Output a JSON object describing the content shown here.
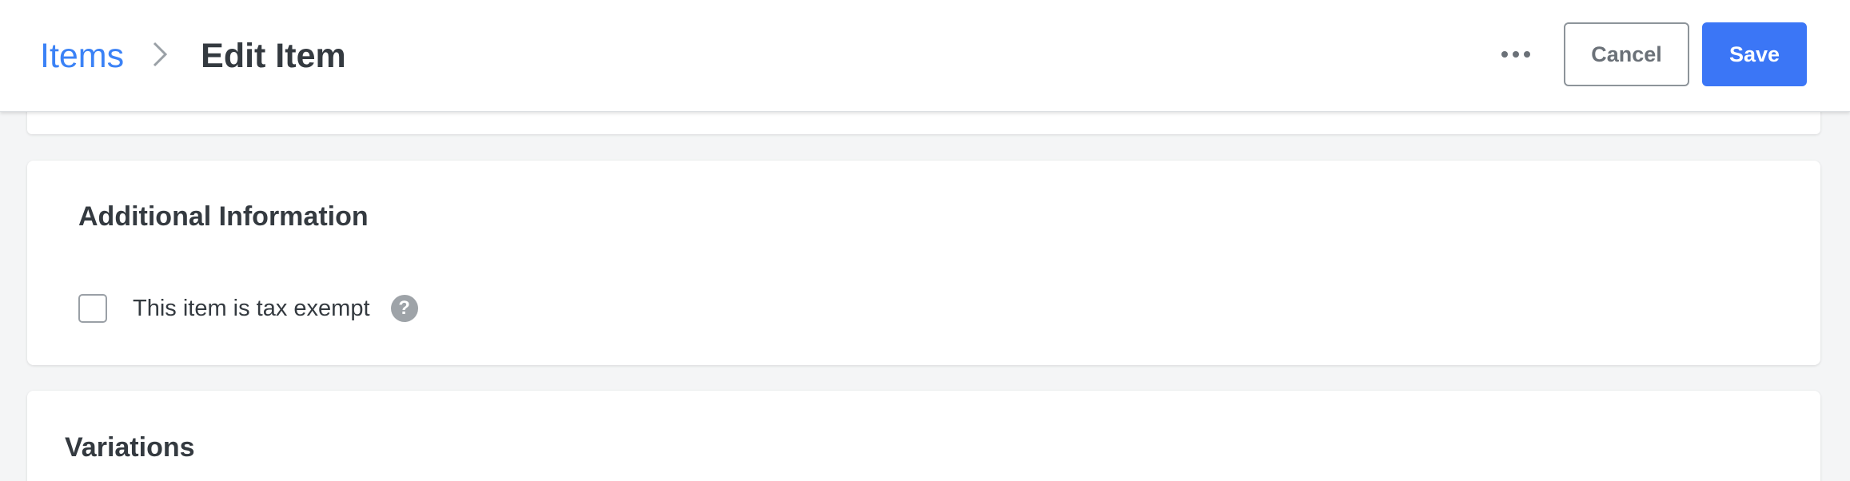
{
  "header": {
    "breadcrumb_parent": "Items",
    "breadcrumb_current": "Edit Item",
    "more_icon": "more-horizontal-icon",
    "cancel_label": "Cancel",
    "save_label": "Save"
  },
  "additional_info": {
    "title": "Additional Information",
    "tax_exempt_label": "This item is tax exempt",
    "tax_exempt_checked": false,
    "help_glyph": "?"
  },
  "variations": {
    "title": "Variations"
  },
  "colors": {
    "accent": "#3b76f6",
    "link": "#3b82f6",
    "background": "#f4f5f6"
  }
}
